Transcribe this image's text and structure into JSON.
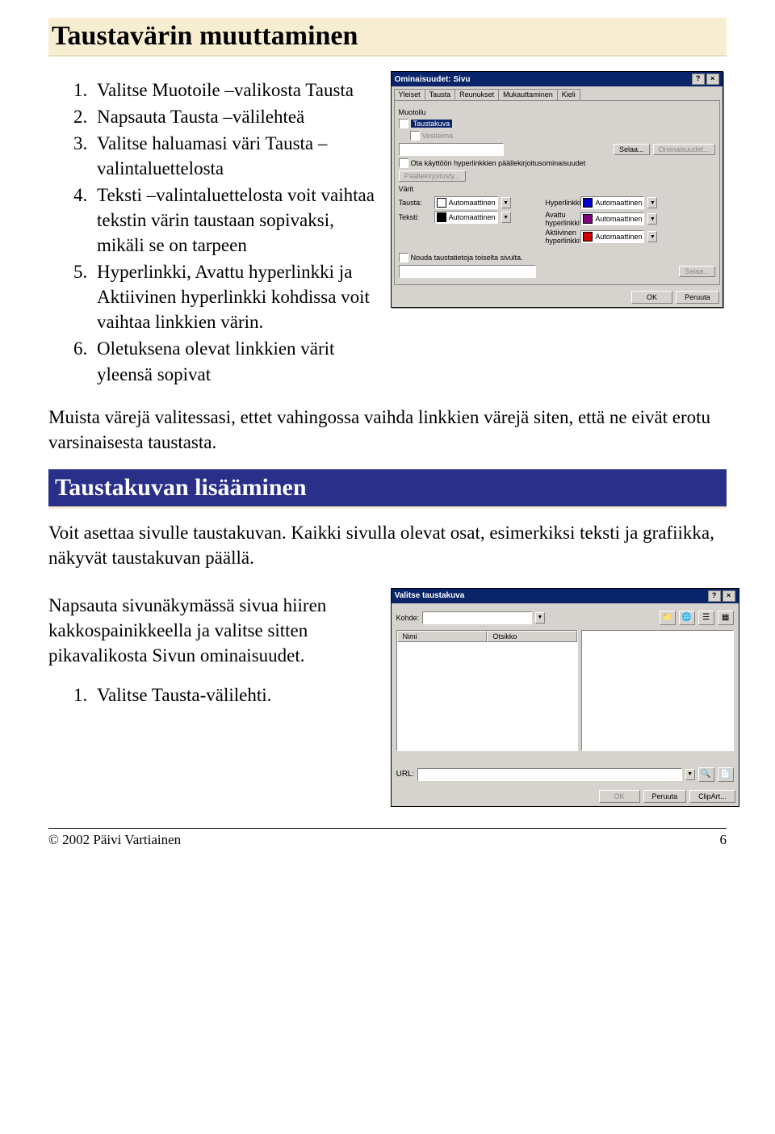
{
  "h1": "Taustavärin muuttaminen",
  "ol1": [
    "Valitse Muotoile –valikosta Tausta",
    "Napsauta Tausta –välilehteä",
    "Valitse haluamasi väri Tausta –valintaluettelosta",
    "Teksti –valintaluettelosta voit vaihtaa tekstin värin taustaan sopivaksi, mikäli se on tarpeen",
    "Hyperlinkki, Avattu hyperlinkki ja Aktiivinen hyperlinkki kohdissa voit vaihtaa linkkien värin.",
    "Oletuksena olevat linkkien värit yleensä sopivat"
  ],
  "p1": "Muista värejä valitessasi, ettet vahingossa vaihda linkkien värejä siten, että ne eivät erotu varsinaisesta taustasta.",
  "h2": "Taustakuvan lisääminen",
  "p2": "Voit asettaa sivulle taustakuvan. Kaikki sivulla olevat osat, esimerkiksi teksti ja grafiikka, näkyvät taustakuvan päällä.",
  "p3": "Napsauta sivunäkymässä sivua hiiren kakkospainikkeella ja valitse sitten pikavalikosta Sivun ominaisuudet.",
  "ol2": [
    "Valitse Tausta-välilehti."
  ],
  "footer": {
    "left": "© 2002 Päivi Vartiainen",
    "right": "6"
  },
  "dialog1": {
    "title": "Ominaisuudet: Sivu",
    "help_icon": "?",
    "close_icon": "×",
    "tabs": [
      "Yleiset",
      "Tausta",
      "Reunukset",
      "Mukauttaminen",
      "Kieli"
    ],
    "active_tab": 1,
    "group_muotoilu": "Muotoilu",
    "chk_taustakuva": "Taustakuva",
    "chk_vesileima": "Vesileima",
    "btn_selaa": "Selaa...",
    "btn_ominaisuudet": "Ominaisuudet...",
    "chk_ota": "Ota käyttöön hyperlinkkien päällekirjoitusominaisuudet",
    "btn_paallekirjoitus": "Päällekirjoitusty...",
    "group_varit": "Värit",
    "rows_left": [
      {
        "label": "Tausta:",
        "value": "Automaattinen",
        "swatch": "#ffffff"
      },
      {
        "label": "Teksti:",
        "value": "Automaattinen",
        "swatch": "#000000"
      }
    ],
    "rows_right": [
      {
        "label": "Hyperlinkki:",
        "value": "Automaattinen",
        "swatch": "#0000cc"
      },
      {
        "label": "Avattu hyperlinkki:",
        "value": "Automaattinen",
        "swatch": "#800080"
      },
      {
        "label": "Aktiivinen hyperlinkki:",
        "value": "Automaattinen",
        "swatch": "#cc0000"
      }
    ],
    "chk_nouda": "Nouda taustatietoja toiselta sivulta.",
    "btn_selaa2": "Selaa...",
    "btn_ok": "OK",
    "btn_peruuta": "Peruuta"
  },
  "dialog2": {
    "title": "Valitse taustakuva",
    "help_icon": "?",
    "close_icon": "×",
    "lbl_kohde": "Kohde:",
    "kohde_value": "",
    "col_nimi": "Nimi",
    "col_otsikko": "Otsikko",
    "lbl_url": "URL:",
    "btn_ok": "OK",
    "btn_peruuta": "Peruuta",
    "btn_clipart": "ClipArt..."
  }
}
